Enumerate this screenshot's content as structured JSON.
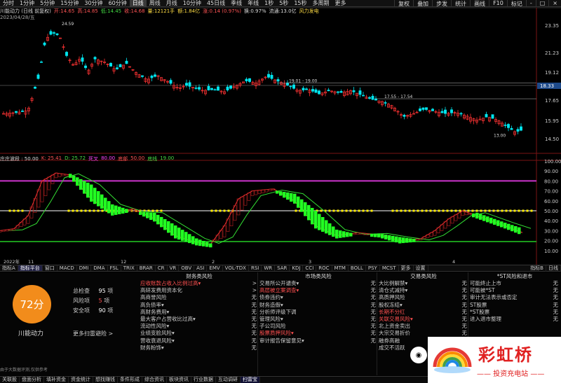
{
  "top_tabs": [
    "分时",
    "1分钟",
    "5分钟",
    "15分钟",
    "30分钟",
    "60分钟",
    "日线",
    "周线",
    "月线",
    "10分钟",
    "45日线",
    "季线",
    "年线",
    "1秒",
    "5秒",
    "15秒",
    "多周期",
    "更多"
  ],
  "top_active_index": 6,
  "top_right": [
    "复权",
    "叠加",
    "步发",
    "统计",
    "画线",
    "F10",
    "标记",
    "-",
    "□",
    "×"
  ],
  "info": {
    "name": "川能动力 (日线 前复权)",
    "open": "开:14.65",
    "high": "高:14.85",
    "low": "低:14.45",
    "close": "收:14.68",
    "amount": "量:12121手",
    "turnover_amt": "额:1.84亿",
    "change": "涨:0.14 (0.97%)",
    "turnover": "换:0.97%",
    "float": "流通:13.0亿",
    "concept": "风力发电"
  },
  "date_label": "2023/04/28/五",
  "price_axis": [
    "23.35",
    "21.23",
    "19.12",
    "17.65",
    "15.95",
    "14.50"
  ],
  "price_tag": "18.33",
  "annotations": {
    "peak": "24.59",
    "a": "19.01 - 19.00",
    "b": "17.55 - 17.54",
    "low": "13.00"
  },
  "indicator": {
    "name": "庄庄波段 : 50.00",
    "k": "K: 25.41",
    "d": "D: 25.72",
    "j": "死叉",
    "v1": "80.00",
    "v2": "底部",
    "v3": "50.00",
    "v4": "底线",
    "v5": "19.00"
  },
  "ind_axis": [
    "100.00",
    "90.00",
    "80.00",
    "70.00",
    "60.00",
    "50.00",
    "40.00",
    "30.00",
    "20.00",
    "10.00"
  ],
  "xaxis": [
    "2022年",
    "11",
    "12",
    "2",
    "3",
    "4"
  ],
  "tabs": [
    "指标A",
    "指标平台",
    "窗口",
    "MACD",
    "DMI",
    "DMA",
    "FSL",
    "TRIX",
    "BRAR",
    "CR",
    "VR",
    "OBV",
    "ASI",
    "EMV",
    "VOL-TDX",
    "RSI",
    "WR",
    "SAR",
    "KDJ",
    "CCI",
    "ROC",
    "MTM",
    "BOLL",
    "PSY",
    "MCST",
    "更多",
    "设置"
  ],
  "tabs_right": [
    "指标B",
    "日线"
  ],
  "risk": {
    "score": "72分",
    "stock": "川能动力",
    "total_label": "总检查",
    "total": "95",
    "total_unit": "项",
    "risk_label": "风险项",
    "risk": "5",
    "risk_unit": "项",
    "safe_label": "安全项",
    "safe": "90",
    "safe_unit": "项",
    "scan": "更多扫雷避险 >",
    "footnote": "由于大数据评测,仅供参考"
  },
  "columns": [
    {
      "title": "财务类风险",
      "rows": [
        {
          "n": "应收账款占收入比例过高▾",
          "s": ">",
          "warn": true
        },
        {
          "n": "高研发费用资本化",
          "s": ">"
        },
        {
          "n": "高商誉风险",
          "s": "无"
        },
        {
          "n": "高负债率▾",
          "s": "无"
        },
        {
          "n": "高财务费用▾",
          "s": "无"
        },
        {
          "n": "最大客户占营收比过高▾",
          "s": "无"
        },
        {
          "n": "流动性风险▾",
          "s": "无"
        },
        {
          "n": "业绩变脸风险▾",
          "s": "无"
        },
        {
          "n": "营收衰退风险▾",
          "s": "无"
        },
        {
          "n": "财务粉饰▾",
          "s": "无"
        }
      ]
    },
    {
      "title": "市场类风险",
      "rows": [
        {
          "n": "交易所公开谴责▾",
          "s": "无"
        },
        {
          "n": "高层被立案调查▾",
          "s": "无",
          "warn": true
        },
        {
          "n": "债券违约▾",
          "s": "无"
        },
        {
          "n": "财务造假▾",
          "s": "无"
        },
        {
          "n": "分析师评级下调",
          "s": "无"
        },
        {
          "n": "管理风险▾",
          "s": "无"
        },
        {
          "n": "子公司风险",
          "s": "无"
        },
        {
          "n": "股票质押风险▾",
          "s": "无",
          "warn": true
        },
        {
          "n": "审计报告保留意见▾",
          "s": "无"
        }
      ]
    },
    {
      "title": "交易类风险",
      "rows": [
        {
          "n": "大比例解禁▾",
          "s": "无"
        },
        {
          "n": "清仓式减持▾",
          "s": "无"
        },
        {
          "n": "高质押风险",
          "s": "无"
        },
        {
          "n": "股权冻结▾",
          "s": "无"
        },
        {
          "n": "长期不分红",
          "s": "无",
          "warn": true
        },
        {
          "n": "关联交易风险▾",
          "s": "无",
          "warn": true
        },
        {
          "n": "北上资金卖出",
          "s": "无"
        },
        {
          "n": "大宗交易折价",
          "s": "无"
        },
        {
          "n": "融券高融",
          "s": "无"
        },
        {
          "n": "成交不活跃",
          "s": "无"
        }
      ]
    },
    {
      "title": "*ST风险和退市",
      "rows": [
        {
          "n": "可能终止上市",
          "s": "无"
        },
        {
          "n": "可能被*ST",
          "s": "无"
        },
        {
          "n": "审计无法表示或否定",
          "s": "无"
        },
        {
          "n": "ST股票",
          "s": "无"
        },
        {
          "n": "*ST股票",
          "s": "无"
        },
        {
          "n": "进入退市整理",
          "s": "无"
        }
      ]
    }
  ],
  "bottom_tabs": [
    "关联股",
    "盘面分析",
    "填补资金",
    "资金统计",
    "想找赚钱",
    "条件形成",
    "综合资讯",
    "板块资讯",
    "行业数据",
    "互动调研",
    "扫雷宝"
  ],
  "bottom_active_index": 10,
  "logo": {
    "brand": "彩虹桥",
    "sub": "—— 投资充电站 ——"
  }
}
